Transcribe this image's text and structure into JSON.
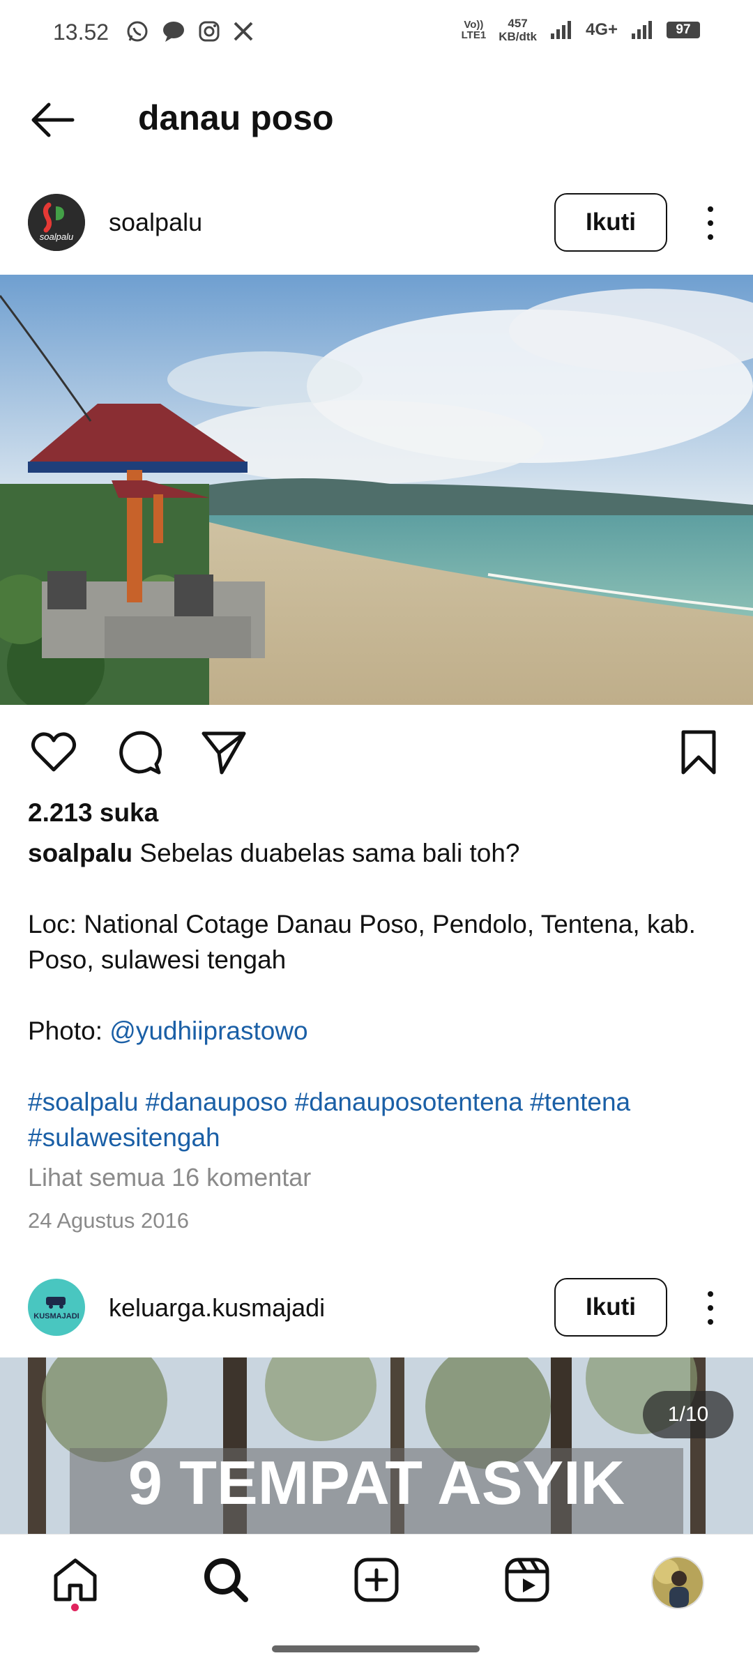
{
  "status_bar": {
    "time": "13.52",
    "net_top": "Vo))",
    "net_bottom": "LTE1",
    "speed_value": "457",
    "speed_unit": "KB/dtk",
    "network_type": "4G+",
    "battery": "97",
    "icons": [
      "whatsapp-icon",
      "message-icon",
      "instagram-icon",
      "x-icon",
      "signal-icon",
      "signal-icon"
    ]
  },
  "header": {
    "title": "danau poso",
    "back_icon": "arrow-left-icon"
  },
  "posts": [
    {
      "username": "soalpalu",
      "avatar_text": "soalpalu",
      "follow_label": "Ikuti",
      "likes": "2.213 suka",
      "caption_user": "soalpalu",
      "caption_text": "Sebelas duabelas sama bali toh?",
      "location_text": "Loc: National Cotage Danau Poso, Pendolo, Tentena, kab. Poso, sulawesi tengah",
      "photo_label": "Photo:",
      "photo_credit": "@yudhiiprastowo",
      "hashtags_line1": "#soalpalu #danauposo #danauposotentena #tentena",
      "hashtags_line2": "#sulawesitengah",
      "comments_link": "Lihat semua 16 komentar",
      "date": "24 Agustus 2016"
    },
    {
      "username": "keluarga.kusmajadi",
      "avatar_text": "KUSMAJADI",
      "follow_label": "Ikuti",
      "slide_counter": "1/10",
      "image_text": "9 TEMPAT ASYIK"
    }
  ],
  "colors": {
    "link": "#1a5fa6",
    "muted": "#8a8a8a",
    "notification_dot": "#e0245e"
  },
  "bottom_nav": [
    "home-icon",
    "search-icon",
    "create-icon",
    "reels-icon",
    "profile-avatar"
  ]
}
